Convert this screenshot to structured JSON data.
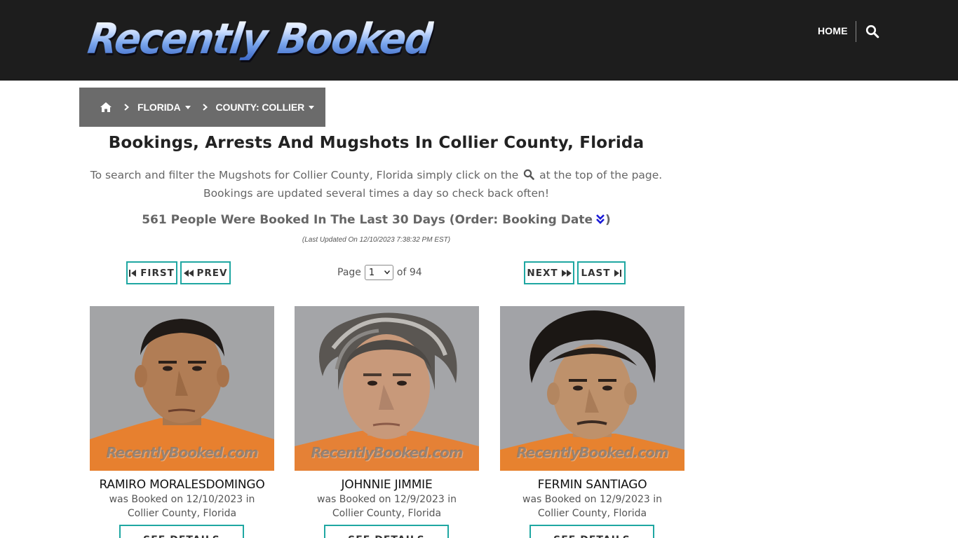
{
  "header": {
    "logo_text": "Recently Booked",
    "nav_home": "HOME",
    "search_icon": "search-icon"
  },
  "breadcrumb": {
    "home_icon": "home-icon",
    "state": "FLORIDA",
    "county": "COUNTY: COLLIER"
  },
  "main": {
    "title": "Bookings, Arrests And Mugshots In Collier County, Florida",
    "intro_before": "To search and filter the Mugshots for Collier County, Florida simply click on the",
    "intro_after": "at the top of the page. Bookings are updated several times a day so check back often!",
    "count_text": "561 People Were Booked In The Last 30 Days (Order: Booking Date",
    "count_close": ")",
    "order_icon": "double-chevron-down-icon",
    "last_updated": "(Last Updated On 12/10/2023 7:38:32 PM EST)"
  },
  "pagination": {
    "first": "FIRST",
    "prev": "PREV",
    "next": "NEXT",
    "last": "LAST",
    "page_label": "Page",
    "current_page": "1",
    "of_label": "of 94"
  },
  "colors": {
    "header_bg": "#1d1d1d",
    "breadcrumb_bg": "#6b6b6b",
    "accent_border": "#1fa7a2",
    "order_icon": "#1a1ad8"
  },
  "cards": [
    {
      "name": "RAMIRO MORALESDOMINGO",
      "booked_line1": "was Booked on 12/10/2023 in",
      "booked_line2": "Collier County, Florida",
      "watermark": "RecentlyBooked.com",
      "button": "SEE DETAILS"
    },
    {
      "name": "JOHNNIE JIMMIE",
      "booked_line1": "was Booked on 12/9/2023 in",
      "booked_line2": "Collier County, Florida",
      "watermark": "RecentlyBooked.com",
      "button": "SEE DETAILS"
    },
    {
      "name": "FERMIN SANTIAGO",
      "booked_line1": "was Booked on 12/9/2023 in",
      "booked_line2": "Collier County, Florida",
      "watermark": "RecentlyBooked.com",
      "button": "SEE DETAILS"
    }
  ]
}
